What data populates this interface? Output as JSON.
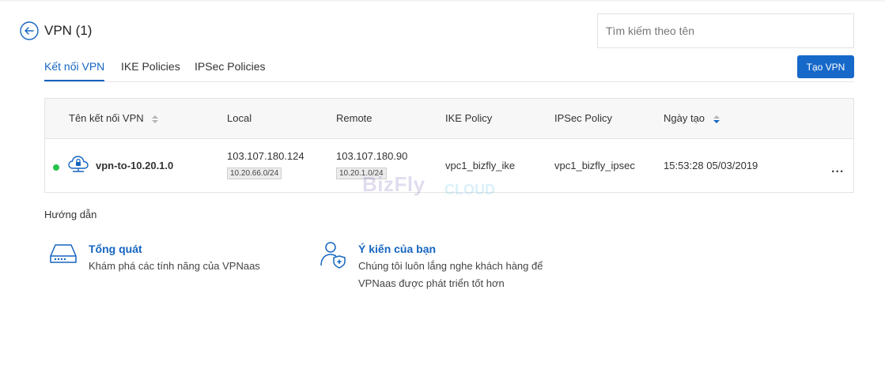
{
  "header": {
    "title": "VPN (1)",
    "search_placeholder": "Tìm kiếm theo tên"
  },
  "tabs": [
    {
      "label": "Kết nối VPN",
      "active": true
    },
    {
      "label": "IKE Policies",
      "active": false
    },
    {
      "label": "IPSec Policies",
      "active": false
    }
  ],
  "create_button": "Tạo VPN",
  "table": {
    "columns": [
      "Tên kết nối VPN",
      "Local",
      "Remote",
      "IKE Policy",
      "IPSec Policy",
      "Ngày tạo"
    ],
    "rows": [
      {
        "name": "vpn-to-10.20.1.0",
        "status": "active",
        "local_ip": "103.107.180.124",
        "local_subnet": "10.20.66.0/24",
        "remote_ip": "103.107.180.90",
        "remote_subnet": "10.20.1.0/24",
        "ike_policy": "vpc1_bizfly_ike",
        "ipsec_policy": "vpc1_bizfly_ipsec",
        "created": "15:53:28 05/03/2019",
        "more": "..."
      }
    ]
  },
  "watermark": {
    "brand": "BizFly",
    "suffix": "CLOUD"
  },
  "guide": {
    "title": "Hướng dẫn",
    "items": [
      {
        "title": "Tổng quát",
        "description": "Khám phá các tính năng của VPNaas",
        "icon": "server-icon"
      },
      {
        "title": "Ý kiến của bạn",
        "description": "Chúng tôi luôn lắng nghe khách hàng để VPNaas được phát triển tốt hơn",
        "icon": "user-shield-icon"
      }
    ]
  },
  "colors": {
    "accent": "#1565c0",
    "button": "#1769c9",
    "status_active": "#27c24c"
  }
}
